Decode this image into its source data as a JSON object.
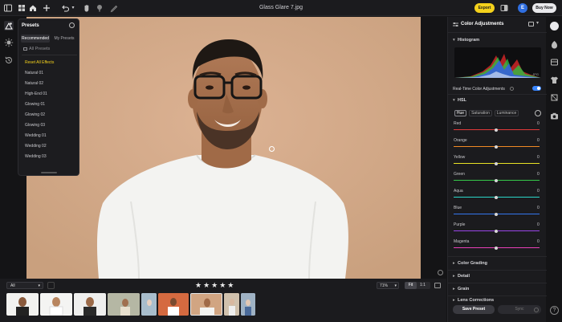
{
  "window_title": "Glass Glare 7.jpg",
  "toolbar": {
    "export_label": "Export",
    "avatar_letter": "E",
    "buy_now_label": "Buy Now"
  },
  "presets_panel": {
    "title": "Presets",
    "tabs": [
      "Recommended",
      "My Presets"
    ],
    "all_presets_label": "All Presets",
    "reset_label": "Reset All Effects",
    "items": [
      "Natural 01",
      "Natural 02",
      "High-End 01",
      "Glowing 01",
      "Glowing 02",
      "Glowing 03",
      "Wedding 01",
      "Wedding 02",
      "Wedding 03"
    ]
  },
  "bottom": {
    "filter_value": "All",
    "rating": "★★★★★",
    "zoom_value": "71%",
    "fit_label": "Fit",
    "one_to_one_label": "1:1"
  },
  "right_panel": {
    "title": "Color Adjustments",
    "histogram_label": "Histogram",
    "histogram_badge": "JPG",
    "realtime_label": "Real-Time Color Adjustments",
    "realtime_on": true,
    "hsl_label": "HSL",
    "hsl_tabs": [
      "Hue",
      "Saturation",
      "Luminance"
    ],
    "sliders": [
      {
        "label": "Red",
        "value": "0",
        "color": "#e23a3a"
      },
      {
        "label": "Orange",
        "value": "0",
        "color": "#f08a24"
      },
      {
        "label": "Yellow",
        "value": "0",
        "color": "#e8e226"
      },
      {
        "label": "Green",
        "value": "0",
        "color": "#35c94a"
      },
      {
        "label": "Aqua",
        "value": "0",
        "color": "#2ad6c8"
      },
      {
        "label": "Blue",
        "value": "0",
        "color": "#3477ee"
      },
      {
        "label": "Purple",
        "value": "0",
        "color": "#9a45e8"
      },
      {
        "label": "Magenta",
        "value": "0",
        "color": "#e83fb8"
      }
    ],
    "sections": [
      "Color Grading",
      "Detail",
      "Grain",
      "Lens Corrections"
    ],
    "save_preset_label": "Save Preset",
    "sync_label": "Sync"
  },
  "colors": {
    "accent": "#f5d21c",
    "toggle": "#3a86ff",
    "background": "#141416",
    "canvas_bg": "#d1a582"
  }
}
